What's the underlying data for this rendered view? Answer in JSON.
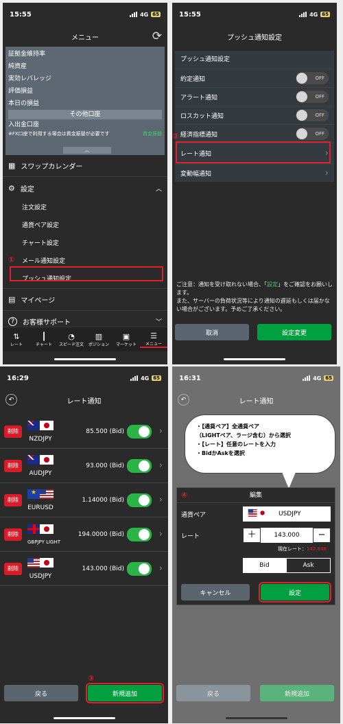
{
  "colors": {
    "accent": "#e0202a",
    "green": "#00a040"
  },
  "p1": {
    "time": "15:55",
    "net": "4G",
    "batt": "65",
    "title": "メニュー",
    "acct_items": [
      "証拠金維持率",
      "純資産",
      "実効レバレッジ",
      "評価損益",
      "本日の損益"
    ],
    "other_header": "その他口座",
    "io_label": "入出金口座",
    "fx_note": "※FX口座で利用する場合は資金振替が必要です",
    "fx_link": "資金振替",
    "swap": "スワップカレンダー",
    "settings": "設定",
    "sub": [
      "注文設定",
      "通貨ペア設定",
      "チャート設定",
      "メール通知設定",
      "プッシュ通知設定"
    ],
    "mypage": "マイページ",
    "support": "お客様サポート",
    "marker": "①",
    "tabs": [
      "レート",
      "チャート",
      "スピード注文",
      "ポジション",
      "マーケット",
      "メニュー"
    ]
  },
  "p2": {
    "time": "15:55",
    "net": "4G",
    "batt": "65",
    "title": "プッシュ通知設定",
    "section": "プッシュ通知設定",
    "items": [
      {
        "label": "約定通知",
        "state": "OFF"
      },
      {
        "label": "アラート通知",
        "state": "OFF"
      },
      {
        "label": "ロスカット通知",
        "state": "OFF"
      },
      {
        "label": "経済指標通知",
        "state": "OFF"
      }
    ],
    "rate": "レート通知",
    "vol": "変動幅通知",
    "marker": "②",
    "notice_a": "ご注意：通知を受け取れない場合、「",
    "notice_link": "設定",
    "notice_b": "」をご確認をお願いします。",
    "notice2": "また、サーバーの負荷状況等により通知の遅延もしくは届かない場合がございます。予めご了承ください。",
    "cancel": "取消",
    "save": "設定変更"
  },
  "p3": {
    "time": "16:29",
    "net": "4G",
    "batt": "65",
    "title": "レート通知",
    "del": "削除",
    "rows": [
      {
        "pair": "NZDJPY",
        "val": "85.500 (Bid)",
        "f1": "nz",
        "f2": "jp"
      },
      {
        "pair": "AUDJPY",
        "val": "93.000 (Bid)",
        "f1": "au",
        "f2": "jp"
      },
      {
        "pair": "EURUSD",
        "val": "1.14000 (Bid)",
        "f1": "eu",
        "f2": "us"
      },
      {
        "pair": "GBPJPY LIGHT",
        "val": "194.0000 (Bid)",
        "f1": "gb",
        "f2": "jp",
        "badge": "LIGHT"
      },
      {
        "pair": "USDJPY",
        "val": "143.000 (Bid)",
        "f1": "us",
        "f2": "jp"
      }
    ],
    "back": "戻る",
    "add": "新規追加",
    "marker": "③"
  },
  "p4": {
    "time": "16:31",
    "net": "4G",
    "batt": "65",
    "title": "レート通知",
    "callout": [
      "・【通貨ペア】全通貨ペア",
      "（LIGHTペア、ラージ含む）から選択",
      "・【レート】任意のレートを入力",
      "・BidかAskを選択"
    ],
    "marker": "④",
    "dlg_title": "編集",
    "pair_label": "通貨ペア",
    "pair": "USDJPY",
    "rate_label": "レート",
    "rate": "143.000",
    "cur_label": "現在レート：",
    "cur_val": "142.848",
    "bid": "Bid",
    "ask": "Ask",
    "cancel": "キャンセル",
    "ok": "設定",
    "back": "戻る",
    "add": "新規追加"
  }
}
